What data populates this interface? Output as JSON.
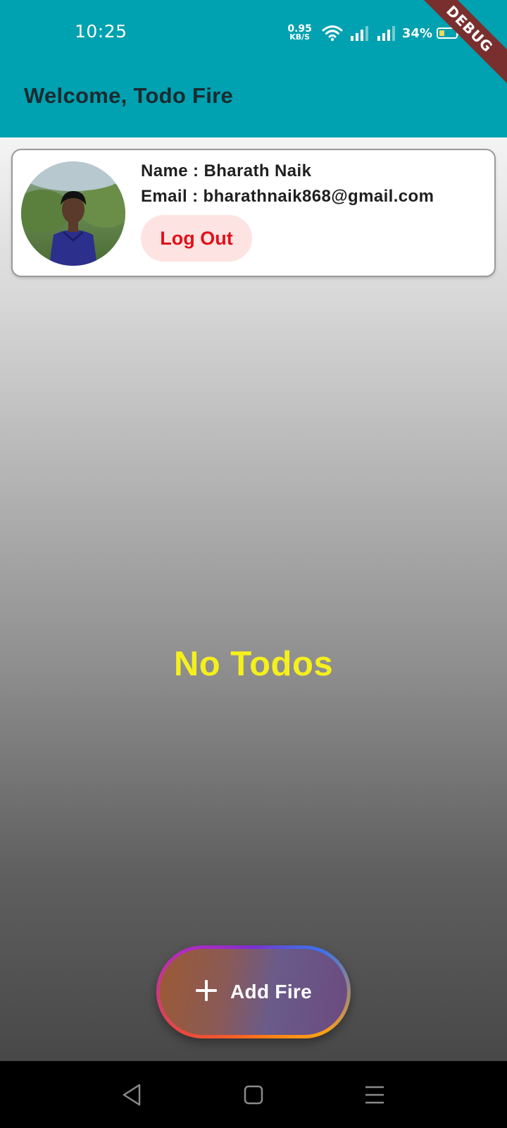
{
  "status_bar": {
    "time": "10:25",
    "net_speed_value": "0.95",
    "net_speed_unit": "KB/S",
    "battery_percent": "34%",
    "battery_level": 0.34,
    "icons": [
      "wifi-icon",
      "signal-icon",
      "signal-icon",
      "battery-icon"
    ]
  },
  "debug_banner": "DEBUG",
  "app_bar": {
    "title": "Welcome, Todo Fire",
    "color": "#00a1b0"
  },
  "profile": {
    "name_line": "Name : Bharath Naik",
    "email_line": "Email : bharathnaik868@gmail.com",
    "logout_label": "Log Out"
  },
  "empty_state": {
    "text": "No Todos",
    "color": "#f5f01c"
  },
  "fab": {
    "icon": "plus-icon",
    "label": "Add Fire"
  },
  "nav_bar": {
    "icons": [
      "back-icon",
      "home-icon",
      "menu-icon"
    ]
  }
}
